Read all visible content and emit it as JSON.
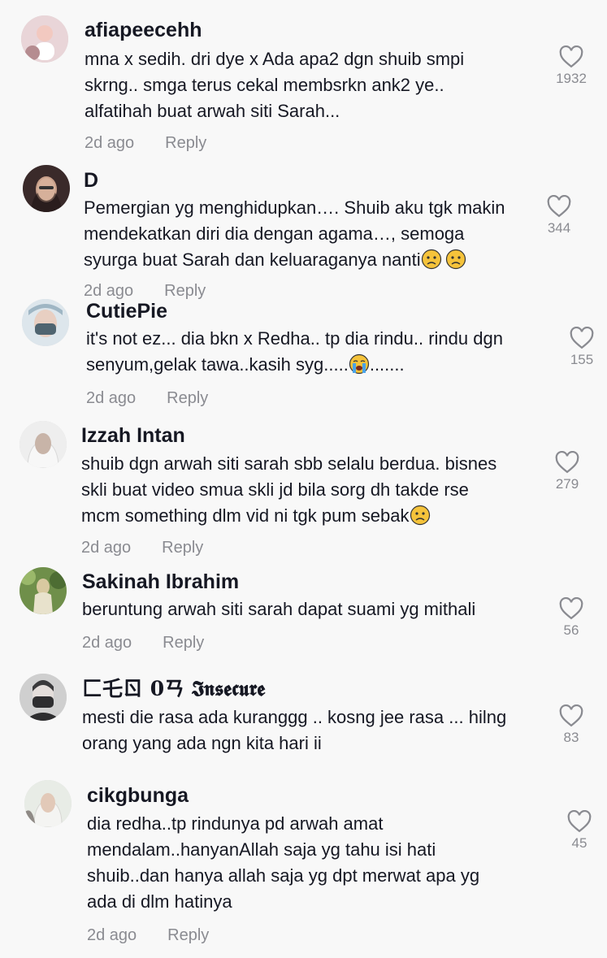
{
  "comments": [
    {
      "username": "afiapeecehh",
      "lines": [
        "mna x sedih. dri dye x Ada apa2 dgn shuib smpi",
        "skrng.. smga terus cekal membsrkn ank2 ye..",
        "alfatihah buat arwah siti Sarah..."
      ],
      "emojis": [],
      "time": "2d ago",
      "reply": "Reply",
      "likes": "1932",
      "avatar_colors": [
        "#e9d5d8",
        "#b58c90"
      ]
    },
    {
      "username": "D",
      "lines": [
        "Pemergian yg menghidupkan…. Shuib aku tgk makin",
        "mendekatkan diri dia dengan agama…, semoga",
        "syurga buat Sarah dan keluaraganya nanti"
      ],
      "emojis": [
        "sad-face",
        "sad-face"
      ],
      "time": "2d ago",
      "reply": "Reply",
      "likes": "344",
      "avatar_colors": [
        "#3a2a2a",
        "#c9a08a"
      ]
    },
    {
      "username": "CutiePie",
      "lines": [
        "it's not ez... dia bkn x Redha.. tp dia rindu.. rindu dgn",
        "senyum,gelak tawa..kasih syg....."
      ],
      "line_suffix": ".......",
      "emojis": [
        "crying-face"
      ],
      "time": "2d ago",
      "reply": "Reply",
      "likes": "155",
      "avatar_colors": [
        "#dde6ec",
        "#4f6470"
      ]
    },
    {
      "username": "Izzah Intan",
      "lines": [
        "shuib dgn arwah siti sarah sbb selalu berdua. bisnes",
        "skli buat video smua skli jd bila sorg dh takde rse",
        "mcm something dlm vid ni tgk pum sebak"
      ],
      "emojis": [
        "sad-face"
      ],
      "time": "2d ago",
      "reply": "Reply",
      "likes": "279",
      "avatar_colors": [
        "#eeeeee",
        "#c8b4a8"
      ]
    },
    {
      "username": "Sakinah Ibrahim",
      "lines": [
        "beruntung arwah siti sarah dapat suami yg mithali"
      ],
      "emojis": [],
      "time": "2d ago",
      "reply": "Reply",
      "likes": "56",
      "avatar_colors": [
        "#6f8f4a",
        "#d8c9a0"
      ]
    },
    {
      "username": "匚乇ㄖ 0ㄢ 𝕴𝖓𝖘𝖊𝖈𝖚𝖗𝖊",
      "lines": [
        "mesti die rasa ada kuranggg .. kosng jee rasa ... hilng",
        "orang yang ada ngn kita hari ii"
      ],
      "emojis": [],
      "time": "",
      "reply": "",
      "likes": "83",
      "avatar_colors": [
        "#cfcfcf",
        "#2e2e30"
      ]
    },
    {
      "username": "cikgbunga",
      "lines": [
        "dia redha..tp rindunya pd arwah amat",
        "mendalam..hanyanAllah saja yg tahu isi hati",
        "shuib..dan hanya allah saja yg dpt merwat apa yg",
        "ada di dlm hatinya"
      ],
      "emojis": [],
      "time": "2d ago",
      "reply": "Reply",
      "likes": "45",
      "avatar_colors": [
        "#e8ece6",
        "#8f8a86"
      ]
    }
  ],
  "colors": {
    "background": "#f8f8f8",
    "text": "#161823",
    "muted": "#8a8b91",
    "heart_stroke": "#8a8b91"
  }
}
